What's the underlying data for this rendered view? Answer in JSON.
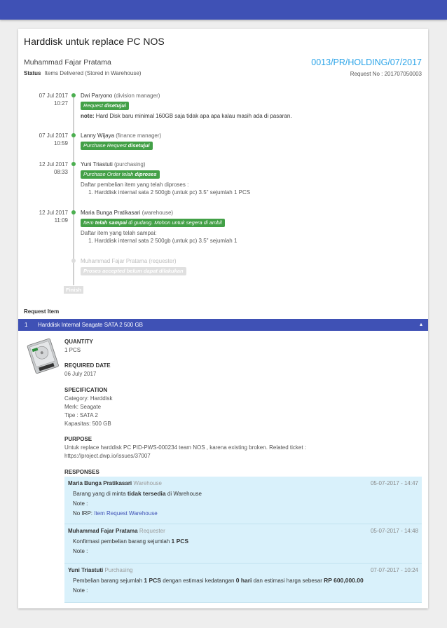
{
  "request": {
    "title": "Harddisk untuk replace PC NOS",
    "requester": "Muhammad Fajar Pratama",
    "status_label": "Status",
    "status_value": "Items Delivered (Stored in Warehouse)",
    "pr_code": "0013/PR/HOLDING/07/2017",
    "request_no": "Request No : 201707050003"
  },
  "timeline": [
    {
      "date": "07 Jul 2017",
      "time": "10:27",
      "name": "Dwi Paryono",
      "role": "(division manager)",
      "badge_pre": "Request ",
      "badge_strong": "disetujui",
      "badge_post": "",
      "note_label": "note:",
      "note": " Hard Disk baru minimal 160GB saja tidak apa apa kalau masih ada di pasaran."
    },
    {
      "date": "07 Jul 2017",
      "time": "10:59",
      "name": "Lanny Wijaya",
      "role": "(finance manager)",
      "badge_pre": "Purchase Request ",
      "badge_strong": "disetujui",
      "badge_post": ""
    },
    {
      "date": "12 Jul 2017",
      "time": "08:33",
      "name": "Yuni Triastuti",
      "role": "(purchasing)",
      "badge_pre": "Purchase Order telah ",
      "badge_strong": "diproses",
      "badge_post": "",
      "sub_title": "Daftar pembelian item yang telah diproses :",
      "sub_item": "Harddisk internal sata 2 500gb (untuk pc) 3.5\" sejumlah 1 PCS"
    },
    {
      "date": "12 Jul 2017",
      "time": "11:09",
      "name": "Maria Bunga Pratikasari",
      "role": "(warehouse)",
      "badge_pre": "Item ",
      "badge_strong": "telah sampai",
      "badge_post": " di gudang. Mohon untuk segera di ambil",
      "sub_title": "Daftar item yang telah sampai:",
      "sub_item": "Harddisk internal sata 2 500gb (untuk pc) 3.5\" sejumlah 1"
    },
    {
      "name": "Muhammad Fajar Pratama",
      "role": "(requester)",
      "badge": "Proses accepted belum dapat dilakukan"
    }
  ],
  "finish_label": "Finish",
  "request_item_label": "Request Item",
  "item": {
    "number": "1",
    "name": "Harddisk Internal Seagate SATA 2 500 GB",
    "caret": "▴",
    "quantity_label": "QUANTITY",
    "quantity": "1 PCS",
    "required_date_label": "REQUIRED DATE",
    "required_date": "06 July 2017",
    "spec_label": "SPECIFICATION",
    "spec": [
      "Category:  Harddisk",
      "Merk:  Seagate",
      "Tipe :  SATA 2",
      "Kapasitas:  500 GB"
    ],
    "purpose_label": "PURPOSE",
    "purpose_1": "Untuk replace harddisk PC PID-PWS-000234 team NOS , karena existing broken. Related ticket :",
    "purpose_2": "https://project.dwp.io/issues/37007",
    "responses_label": "RESPONSES"
  },
  "responses": [
    {
      "name": "Maria Bunga Pratikasari",
      "role": "Warehouse",
      "time": "05-07-2017 - 14:47",
      "l1_pre": "Barang yang di minta ",
      "l1_strong": "tidak tersedia",
      "l1_post": " di Warehouse",
      "note": "Note :",
      "irp_label": "No IRP: ",
      "irp_link": "Item Request Warehouse"
    },
    {
      "name": "Muhammad Fajar Pratama",
      "role": "Requester",
      "time": "05-07-2017 - 14:48",
      "l1_pre": "Konfirmasi pembelian barang sejumlah ",
      "l1_strong": "1 PCS",
      "note": "Note :"
    },
    {
      "name": "Yuni Triastuti",
      "role": "Purchasing",
      "time": "07-07-2017 - 10:24",
      "l1_a": "Pembelian barang sejumlah ",
      "l1_b": "1 PCS",
      "l1_c": " dengan estimasi kedatangan ",
      "l1_d": "0 hari",
      "l1_e": " dan estimasi harga sebesar ",
      "l1_f": "RP 600,000.00",
      "note": "Note :"
    }
  ]
}
